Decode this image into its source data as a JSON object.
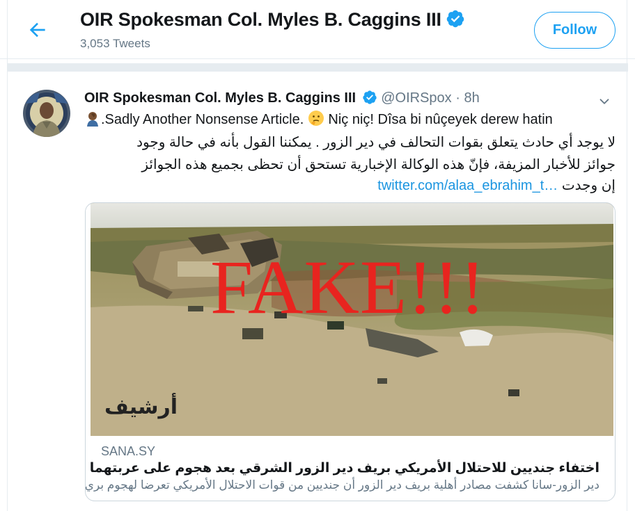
{
  "header": {
    "title": "OIR Spokesman Col. Myles B. Caggins III",
    "tweet_count": "3,053 Tweets",
    "follow_label": "Follow"
  },
  "tweet": {
    "author_name": "OIR Spokesman Col. Myles B. Caggins III",
    "handle": "@OIRSpox",
    "separator": "·",
    "time": "8h",
    "line1_a": ".Sadly Another Nonsense Article. ",
    "line1_b": " Niç niç! Dîsa bi nûçeyek derew hatin",
    "line2": "لا يوجد أي حادث يتعلق بقوات التحالف في دير الزور . يمكننا القول بأنه في حالة وجود",
    "line3": "جوائز للأخبار المزيفة، فإنّ هذه الوكالة الإخبارية تستحق أن تحظى بجميع هذه الجوائز",
    "line4_text": "إن وجدت",
    "line4_link": "twitter.com/alaa_ebrahim_t…"
  },
  "card": {
    "image_overlay_text": "FAKE!!!",
    "image_archive_label": "أرشيف",
    "site": "SANA.SY",
    "title": "اختفاء جنديين للاحتلال الأمريكي بريف دير الزور الشرقي بعد هجوم على عربتهما - SANA",
    "description": "دير الزور-سانا كشفت مصادر أهلية بريف دير الزور أن جنديين من قوات الاحتلال الأمريكي تعرضا لهجوم بري..."
  },
  "colors": {
    "accent": "#1da1f2",
    "link": "#1b95e0",
    "muted": "#657786",
    "border": "#e6ecf0",
    "fake_red": "#e8241f"
  },
  "icons": {
    "back": "back-arrow-icon",
    "verified": "verified-badge-icon",
    "caret": "chevron-down-icon",
    "emoji_person": "person-facepalming-emoji",
    "emoji_thinking": "thinking-face-emoji"
  }
}
